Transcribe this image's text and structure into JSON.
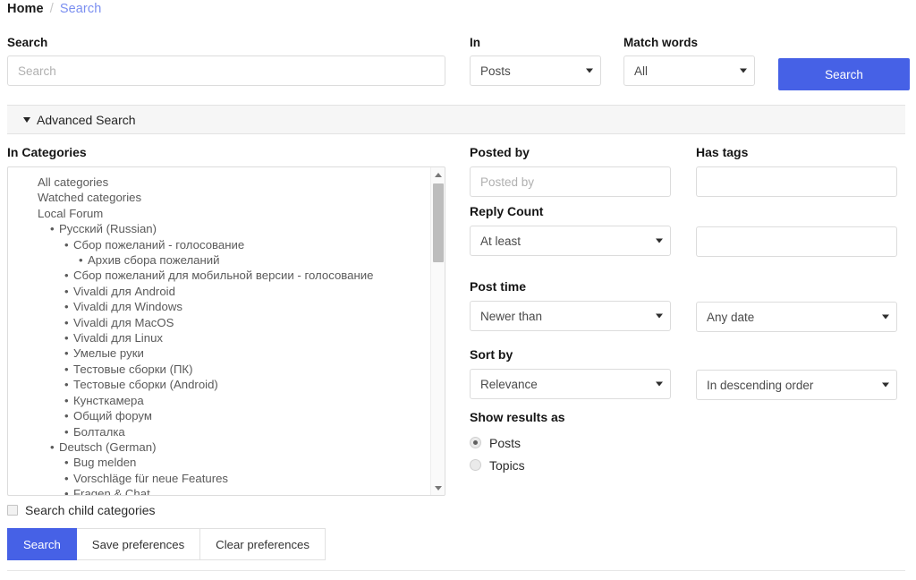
{
  "breadcrumb": {
    "home": "Home",
    "separator": "/",
    "current": "Search"
  },
  "top": {
    "search_label": "Search",
    "search_placeholder": "Search",
    "search_value": "",
    "in_label": "In",
    "in_value": "Posts",
    "match_label": "Match words",
    "match_value": "All",
    "search_button": "Search"
  },
  "advanced": {
    "title": "Advanced Search"
  },
  "categories": {
    "label": "In Categories",
    "items": [
      {
        "text": "All categories",
        "level": 0,
        "bullet": false
      },
      {
        "text": "Watched categories",
        "level": 0,
        "bullet": false
      },
      {
        "text": "Local Forum",
        "level": 0,
        "bullet": false
      },
      {
        "text": "Русский (Russian)",
        "level": 1,
        "bullet": true
      },
      {
        "text": "Сбор пожеланий - голосование",
        "level": 2,
        "bullet": true
      },
      {
        "text": "Архив сбора пожеланий",
        "level": 3,
        "bullet": true
      },
      {
        "text": "Сбор пожеланий для мобильной версии - голосование",
        "level": 2,
        "bullet": true
      },
      {
        "text": "Vivaldi для Android",
        "level": 2,
        "bullet": true
      },
      {
        "text": "Vivaldi для Windows",
        "level": 2,
        "bullet": true
      },
      {
        "text": "Vivaldi для MacOS",
        "level": 2,
        "bullet": true
      },
      {
        "text": "Vivaldi для Linux",
        "level": 2,
        "bullet": true
      },
      {
        "text": "Умелые руки",
        "level": 2,
        "bullet": true
      },
      {
        "text": "Тестовые сборки (ПК)",
        "level": 2,
        "bullet": true
      },
      {
        "text": "Тестовые сборки (Android)",
        "level": 2,
        "bullet": true
      },
      {
        "text": "Кунсткамера",
        "level": 2,
        "bullet": true
      },
      {
        "text": "Общий форум",
        "level": 2,
        "bullet": true
      },
      {
        "text": "Болталка",
        "level": 2,
        "bullet": true
      },
      {
        "text": "Deutsch (German)",
        "level": 1,
        "bullet": true
      },
      {
        "text": "Bug melden",
        "level": 2,
        "bullet": true
      },
      {
        "text": "Vorschläge für neue Features",
        "level": 2,
        "bullet": true
      },
      {
        "text": "Fragen & Chat",
        "level": 2,
        "bullet": true
      }
    ],
    "child_checkbox_label": "Search child categories",
    "child_checkbox_checked": false
  },
  "filters": {
    "posted_by_label": "Posted by",
    "posted_by_placeholder": "Posted by",
    "posted_by_value": "",
    "has_tags_label": "Has tags",
    "has_tags_value": "",
    "reply_count_label": "Reply Count",
    "reply_count_value": "At least",
    "reply_count_number": "",
    "post_time_label": "Post time",
    "post_time_value": "Newer than",
    "post_date_value": "Any date",
    "sort_by_label": "Sort by",
    "sort_by_value": "Relevance",
    "sort_order_value": "In descending order",
    "show_results_label": "Show results as",
    "show_results_options": [
      {
        "label": "Posts",
        "selected": true
      },
      {
        "label": "Topics",
        "selected": false
      }
    ]
  },
  "buttons": {
    "search": "Search",
    "save_preferences": "Save preferences",
    "clear_preferences": "Clear preferences"
  },
  "colors": {
    "accent": "#4661e6",
    "link": "#7b8ff0",
    "bar_bg": "#f6f6f6"
  }
}
